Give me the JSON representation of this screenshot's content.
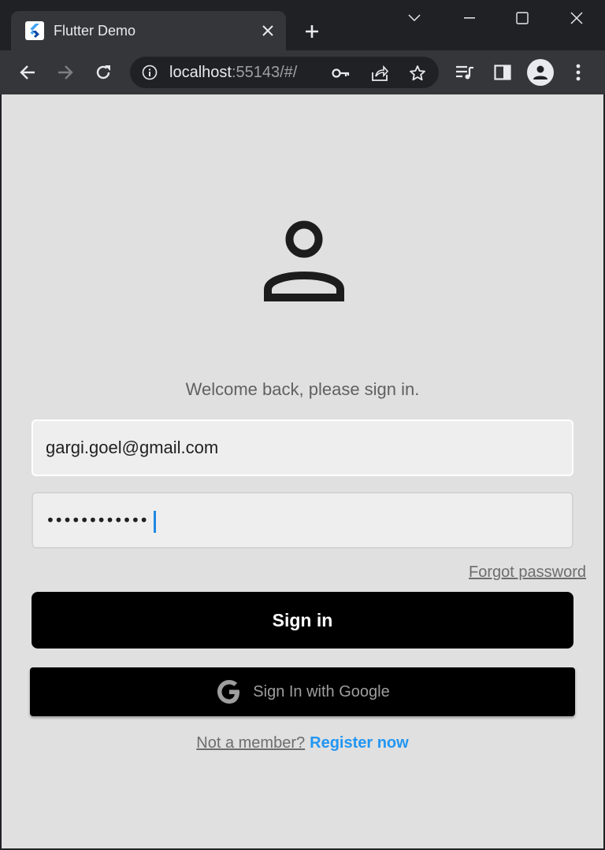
{
  "browser": {
    "tab_title": "Flutter Demo",
    "url_host": "localhost",
    "url_rest": ":55143/#/"
  },
  "colors": {
    "page_bg": "#e0e0e0",
    "button_bg": "#000000",
    "link_accent": "#2196f3",
    "caret": "#1e88e5"
  },
  "login": {
    "welcome_text": "Welcome back, please sign in.",
    "email_value": "gargi.goel@gmail.com",
    "password_mask": "••••••••••••",
    "forgot_label": "Forgot password",
    "signin_label": "Sign in",
    "google_label": "Sign In with Google",
    "not_member_label": "Not a member?",
    "register_label": "Register now"
  },
  "icons": {
    "avatar": "person-outline-icon",
    "google": "google-g-icon"
  }
}
